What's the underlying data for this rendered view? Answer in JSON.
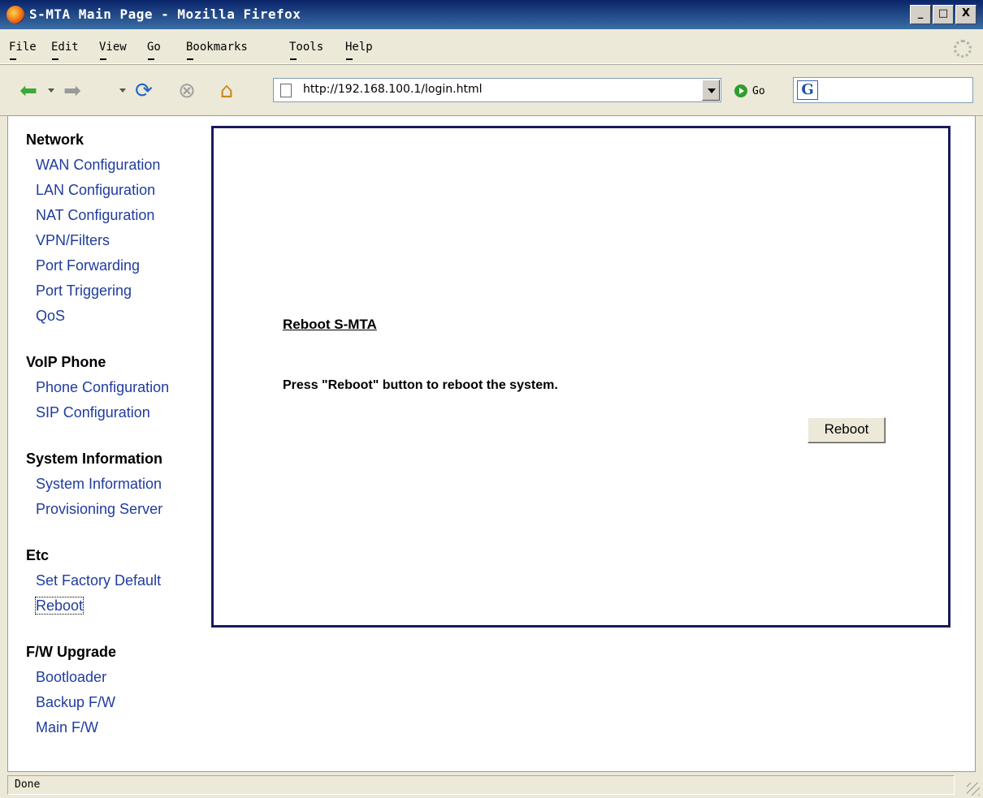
{
  "window": {
    "title": "S-MTA Main Page - Mozilla Firefox",
    "buttons": [
      "_",
      "□",
      "X"
    ]
  },
  "menu": [
    "File",
    "Edit",
    "View",
    "Go",
    "Bookmarks",
    "Tools",
    "Help"
  ],
  "toolbar": {
    "url": "http://192.168.100.1/login.html",
    "go_label": "Go",
    "icons": [
      "back-icon",
      "forward-icon",
      "reload-icon",
      "stop-icon",
      "home-icon",
      "google-search-icon"
    ]
  },
  "sidebar": {
    "sections": [
      {
        "heading": "Network",
        "links": [
          "WAN Configuration",
          "LAN Configuration",
          "NAT Configuration",
          "VPN/Filters",
          "Port Forwarding",
          "Port Triggering",
          "QoS"
        ]
      },
      {
        "heading": "VoIP Phone",
        "links": [
          "Phone Configuration",
          "SIP Configuration"
        ]
      },
      {
        "heading": "System Information",
        "links": [
          "System Information",
          "Provisioning Server"
        ]
      },
      {
        "heading": "Etc",
        "links": [
          "Set Factory Default",
          "Reboot"
        ]
      },
      {
        "heading": "F/W Upgrade",
        "links": [
          "Bootloader",
          "Backup F/W",
          "Main F/W"
        ]
      }
    ],
    "focused_link": "Reboot"
  },
  "panel": {
    "title": "Reboot S-MTA",
    "instruction": "Press \"Reboot\" button to reboot the system.",
    "button_label": "Reboot"
  },
  "status": {
    "text": "Done"
  },
  "colors": {
    "link": "#1f3c9e",
    "panel_border": "#191a5c",
    "titlebar": "#0a246a"
  }
}
